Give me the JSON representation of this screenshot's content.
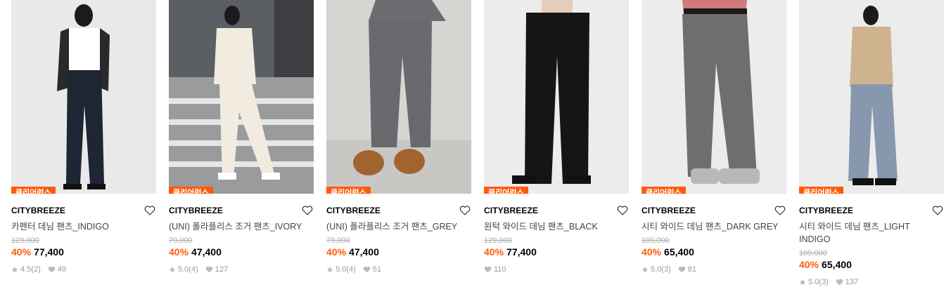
{
  "products": [
    {
      "brand": "CITYBREEZE",
      "name": "카펜터 데님 팬츠_INDIGO",
      "badge": "클리어런스",
      "orig": "129,000",
      "discount": "40%",
      "price": "77,400",
      "rating": "4.5",
      "reviews": "(2)",
      "likes": "49",
      "bg": "#e9e9ea"
    },
    {
      "brand": "CITYBREEZE",
      "name": "(UNI) 폴라플리스 조거 팬츠_IVORY",
      "badge": "클리어런스",
      "orig": "79,000",
      "discount": "40%",
      "price": "47,400",
      "rating": "5.0",
      "reviews": "(4)",
      "likes": "127",
      "bg": "#8d8f91"
    },
    {
      "brand": "CITYBREEZE",
      "name": "(UNI) 폴라플리스 조거 팬츠_GREY",
      "badge": "클리어런스",
      "orig": "79,000",
      "discount": "40%",
      "price": "47,400",
      "rating": "5.0",
      "reviews": "(4)",
      "likes": "51",
      "bg": "#d7d5d2"
    },
    {
      "brand": "CITYBREEZE",
      "name": "원턱 와이드 데님 팬츠_BLACK",
      "badge": "클리어런스",
      "orig": "129,000",
      "discount": "40%",
      "price": "77,400",
      "rating": "",
      "reviews": "",
      "likes": "110",
      "bg": "#ececec"
    },
    {
      "brand": "CITYBREEZE",
      "name": "시티 와이드 데님 팬츠_DARK GREY",
      "badge": "클리어런스",
      "orig": "109,000",
      "discount": "40%",
      "price": "65,400",
      "rating": "5.0",
      "reviews": "(3)",
      "likes": "81",
      "bg": "#ececec"
    },
    {
      "brand": "CITYBREEZE",
      "name": "시티 와이드 데님 팬츠_LIGHT INDIGO",
      "badge": "클리어런스",
      "orig": "109,000",
      "discount": "40%",
      "price": "65,400",
      "rating": "5.0",
      "reviews": "(3)",
      "likes": "137",
      "bg": "#ececec"
    }
  ],
  "colors": {
    "accent": "#ff5a0a"
  }
}
